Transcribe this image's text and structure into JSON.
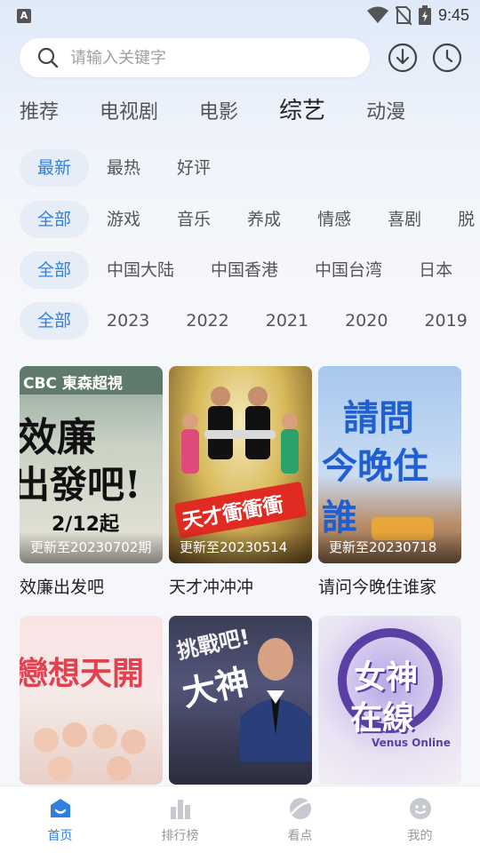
{
  "status_bar": {
    "time": "9:45",
    "app_letter": "A"
  },
  "search": {
    "placeholder": "请输入关键字"
  },
  "top_icons": [
    "download-icon",
    "history-icon"
  ],
  "category_tabs": [
    {
      "label": "推荐"
    },
    {
      "label": "电视剧"
    },
    {
      "label": "电影"
    },
    {
      "label": "综艺",
      "active": true
    },
    {
      "label": "动漫"
    }
  ],
  "filters": {
    "sort": [
      "最新",
      "最热",
      "好评"
    ],
    "genre": [
      "全部",
      "游戏",
      "音乐",
      "养成",
      "情感",
      "喜剧",
      "脱"
    ],
    "region": [
      "全部",
      "中国大陆",
      "中国香港",
      "中国台湾",
      "日本"
    ],
    "year": [
      "全部",
      "2023",
      "2022",
      "2021",
      "2020",
      "2019"
    ]
  },
  "cards": [
    {
      "title": "效廉出发吧",
      "update": "更新至20230702期",
      "poster_text": [
        "CBC 東森超視",
        "效廉",
        "出發吧!",
        "2/12起"
      ]
    },
    {
      "title": "天才冲冲冲",
      "update": "更新至20230514",
      "poster_text": [
        "天才衝衝衝"
      ]
    },
    {
      "title": "请问今晚住谁家",
      "update": "更新至20230718",
      "poster_text": [
        "請問",
        "今晚住誰"
      ]
    },
    {
      "title": "",
      "update": "",
      "poster_text": [
        "戀想天開"
      ]
    },
    {
      "title": "",
      "update": "",
      "poster_text": [
        "挑戰吧!",
        "大神"
      ]
    },
    {
      "title": "",
      "update": "",
      "poster_text": [
        "女神",
        "在線",
        "Venus Online"
      ]
    }
  ],
  "bottom_nav": [
    {
      "label": "首页",
      "icon": "home-icon",
      "active": true
    },
    {
      "label": "排行榜",
      "icon": "ranking-icon"
    },
    {
      "label": "看点",
      "icon": "discover-icon"
    },
    {
      "label": "我的",
      "icon": "profile-icon"
    }
  ],
  "colors": {
    "accent": "#2f7fe0",
    "chip_active_bg": "#e6edf7"
  }
}
